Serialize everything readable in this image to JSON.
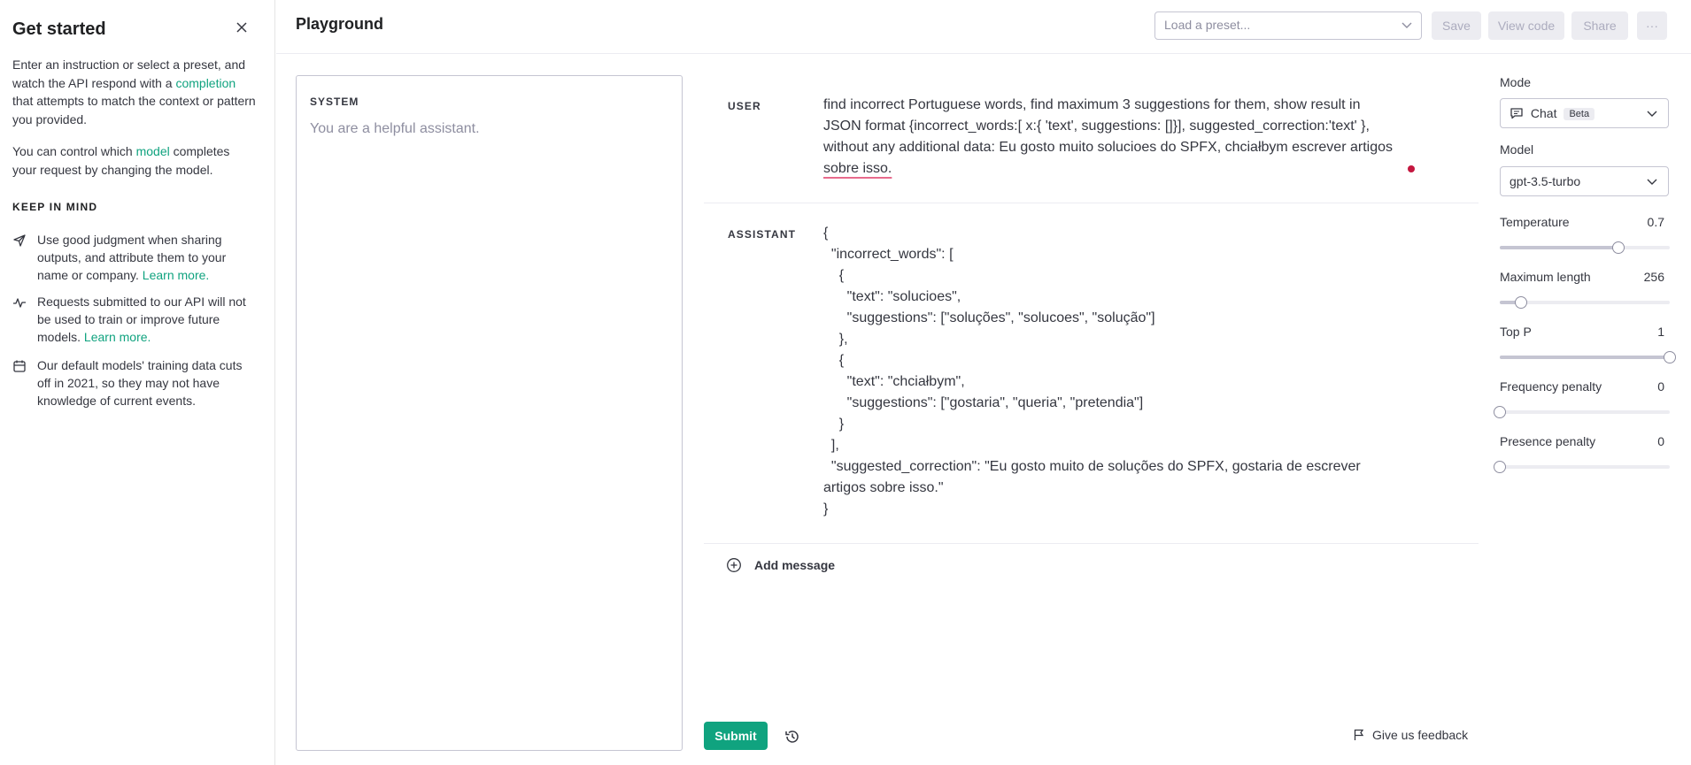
{
  "sidebar": {
    "title": "Get started",
    "intro_1": "Enter an instruction or select a preset, and watch the API respond with a",
    "intro_link": "completion",
    "intro_2": "that attempts to match the context or pattern you provided.",
    "model_1": "You can control which",
    "model_link": "model",
    "model_2": "completes your request by changing the model.",
    "keep_in_mind": "KEEP IN MIND",
    "notes": [
      {
        "text": "Use good judgment when sharing outputs, and attribute them to your name or company.",
        "link": "Learn more."
      },
      {
        "text": "Requests submitted to our API will not be used to train or improve future models.",
        "link": "Learn more."
      },
      {
        "text": "Our default models' training data cuts off in 2021, so they may not have knowledge of current events.",
        "link": ""
      }
    ]
  },
  "header": {
    "title": "Playground",
    "preset_placeholder": "Load a preset...",
    "save": "Save",
    "view_code": "View code",
    "share": "Share",
    "more": "···"
  },
  "system": {
    "label": "SYSTEM",
    "placeholder": "You are a helpful assistant."
  },
  "messages": {
    "user_label": "USER",
    "user_text_lines": [
      "find incorrect Portuguese words, find maximum 3 suggestions for them, show result in",
      "JSON format {incorrect_words:[ x:{ 'text', suggestions: []}], suggested_correction:'text' },",
      "without any additional data: Eu gosto muito solucioes do SPFX, chciałbym escrever artigos",
      "sobre isso."
    ],
    "assistant_label": "ASSISTANT",
    "assistant_text": "{\n  \"incorrect_words\": [\n    {\n      \"text\": \"solucioes\",\n      \"suggestions\": [\"soluções\", \"solucoes\", \"solução\"]\n    },\n    {\n      \"text\": \"chciałbym\",\n      \"suggestions\": [\"gostaria\", \"queria\", \"pretendia\"]\n    }\n  ],\n  \"suggested_correction\": \"Eu gosto muito de soluções do SPFX, gostaria de escrever\nartigos sobre isso.\"\n}",
    "add_message": "Add message"
  },
  "footer": {
    "submit": "Submit",
    "feedback": "Give us feedback"
  },
  "settings": {
    "mode_label": "Mode",
    "mode_value": "Chat",
    "mode_badge": "Beta",
    "model_label": "Model",
    "model_value": "gpt-3.5-turbo",
    "temperature": {
      "label": "Temperature",
      "value": "0.7",
      "fraction": 0.7
    },
    "max_length": {
      "label": "Maximum length",
      "value": "256",
      "fraction": 0.125
    },
    "top_p": {
      "label": "Top P",
      "value": "1",
      "fraction": 1.0
    },
    "frequency_penalty": {
      "label": "Frequency penalty",
      "value": "0",
      "fraction": 0.0
    },
    "presence_penalty": {
      "label": "Presence penalty",
      "value": "0",
      "fraction": 0.0
    }
  },
  "colors": {
    "accent": "#10a37f",
    "spell_underline": "#e86a8c",
    "dot": "#c4173f"
  }
}
